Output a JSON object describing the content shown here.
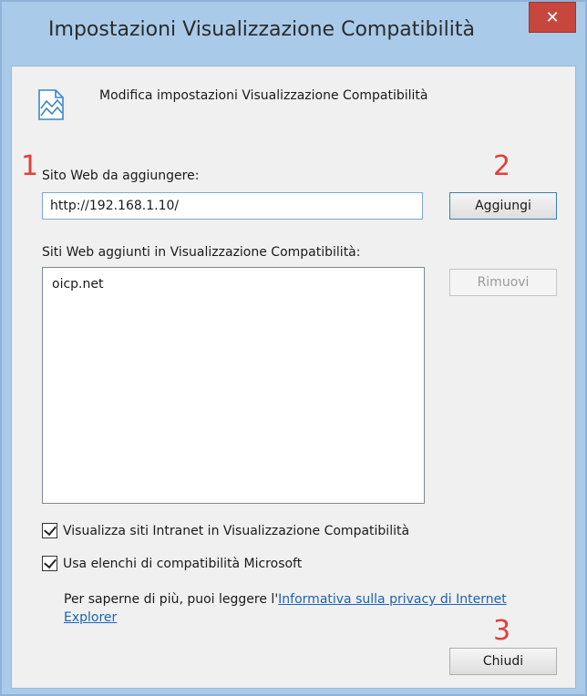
{
  "window": {
    "title": "Impostazioni Visualizzazione Compatibilità",
    "close_glyph": "✕"
  },
  "header": {
    "icon": "compatibility-view-icon",
    "text": "Modifica impostazioni Visualizzazione Compatibilità"
  },
  "annotations": {
    "step1": "1",
    "step2": "2",
    "step3": "3",
    "color": "#e0403a"
  },
  "add_site": {
    "label": "Sito Web da aggiungere:",
    "value": "http://192.168.1.10/",
    "button": "Aggiungi"
  },
  "site_list": {
    "label": "Siti Web aggiunti in Visualizzazione Compatibilità:",
    "items": [
      "oicp.net"
    ],
    "remove_button": "Rimuovi"
  },
  "options": {
    "intranet_label": "Visualizza siti Intranet in Visualizzazione Compatibilità",
    "intranet_checked": true,
    "microsoft_lists_label": "Usa elenchi di compatibilità Microsoft",
    "microsoft_lists_checked": true
  },
  "info": {
    "prefix": "Per saperne di più, puoi leggere l'",
    "link": "Informativa sulla privacy di Internet Explorer"
  },
  "footer": {
    "close_button": "Chiudi"
  }
}
